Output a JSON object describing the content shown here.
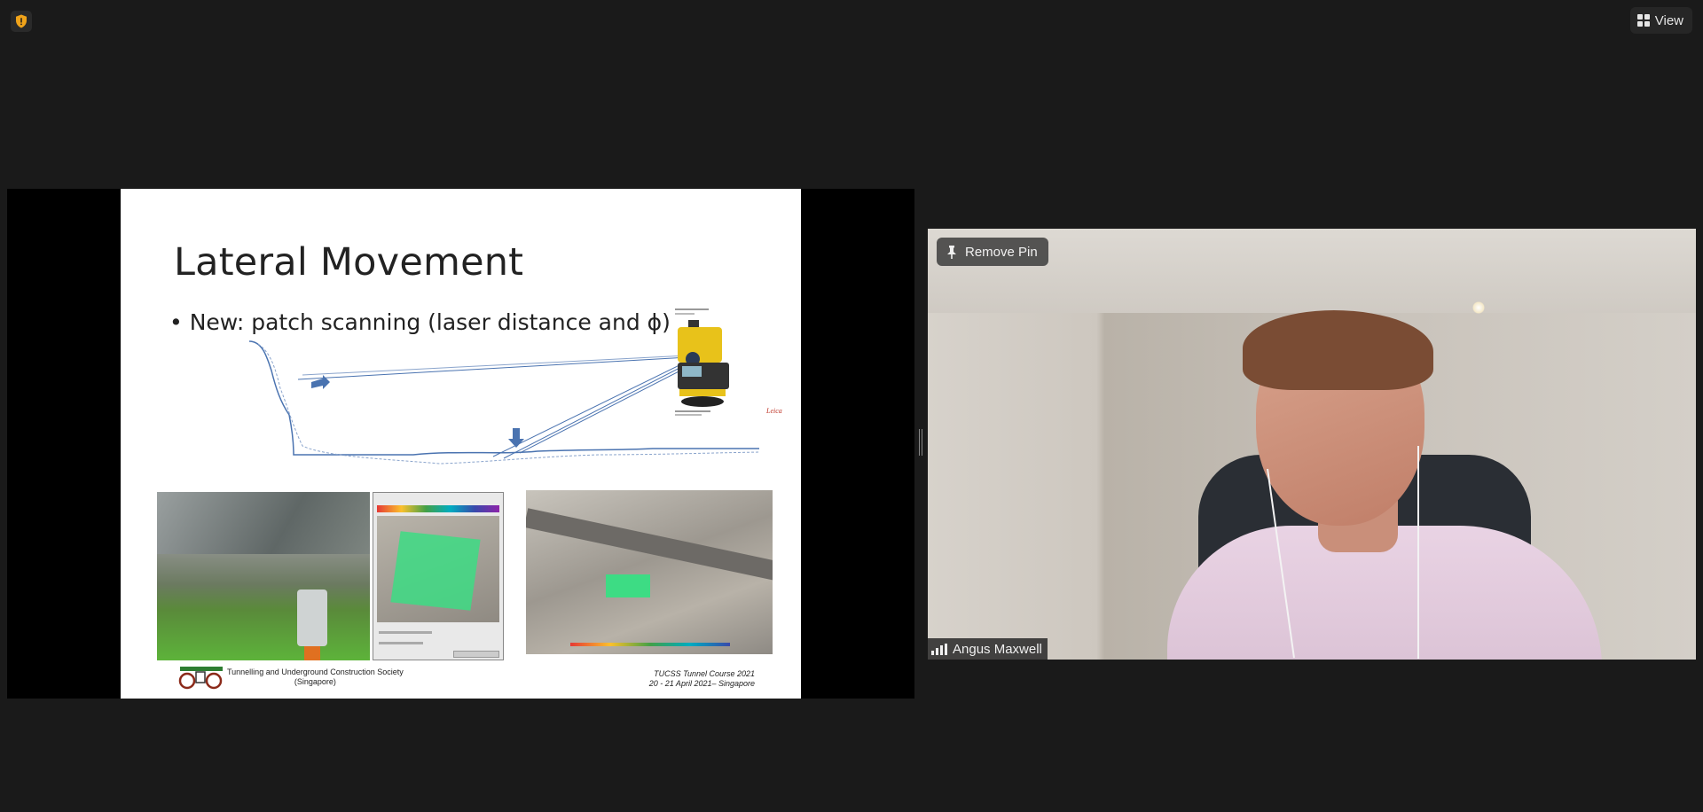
{
  "toolbar": {
    "view_label": "View"
  },
  "icons": {
    "security": "shield-alert-icon",
    "view": "grid-icon",
    "pin": "pin-icon",
    "signal": "signal-bars-icon"
  },
  "colors": {
    "background": "#1a1a1a",
    "security_badge": "#f0a31a",
    "instrument_yellow": "#e8c21a",
    "scan_green": "#3ddc84"
  },
  "slide": {
    "title": "Lateral Movement",
    "bullet": "• New: patch scanning (laser distance and ϕ)",
    "footer_left_line1": "Tunnelling and Underground Construction Society",
    "footer_left_line2": "(Singapore)",
    "footer_right_line1": "TUCSS Tunnel Course 2021",
    "footer_right_line2": "20 - 21 April 2021– Singapore"
  },
  "participant": {
    "remove_pin_label": "Remove Pin",
    "name": "Angus Maxwell"
  }
}
